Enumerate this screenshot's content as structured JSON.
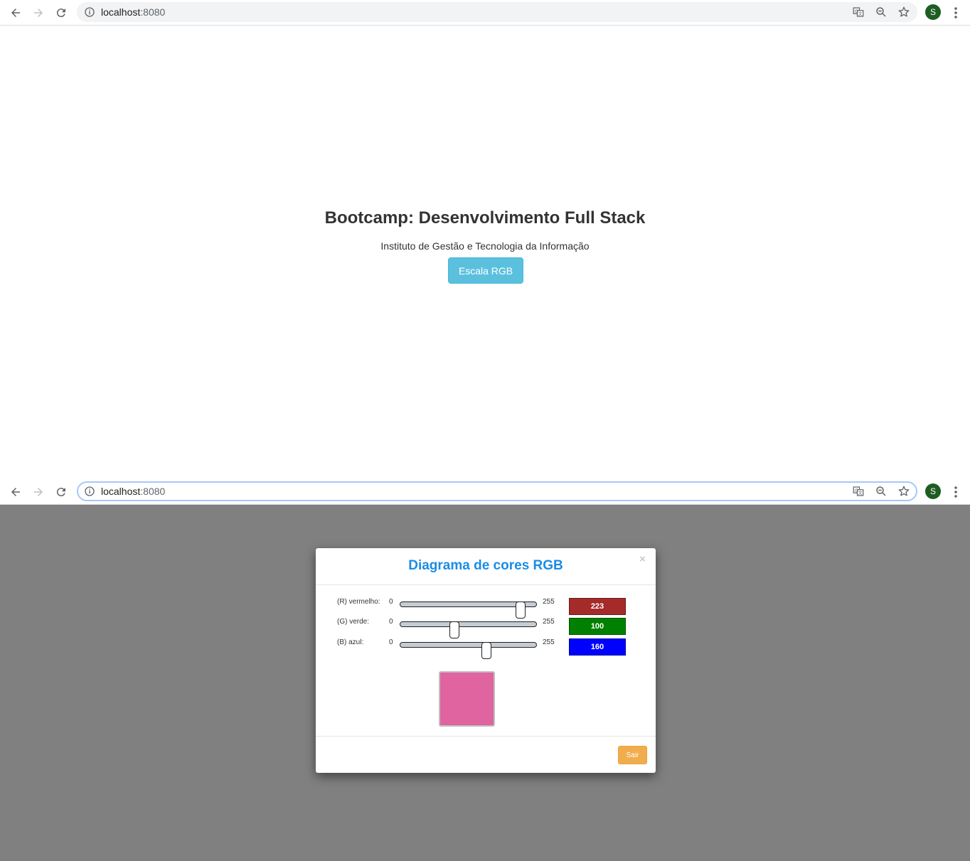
{
  "browser": {
    "url_host": "localhost",
    "url_port": ":8080",
    "profile_initial": "S"
  },
  "page": {
    "title": "Bootcamp: Desenvolvimento Full Stack",
    "subtitle": "Instituto de Gestão e Tecnologia da Informação",
    "open_button_label": "Escala RGB"
  },
  "modal": {
    "title": "Diagrama de cores RGB",
    "close_glyph": "×",
    "sliders": [
      {
        "label": "(R) vermelho:",
        "min": "0",
        "max": "255",
        "value": "223",
        "color": "#a52a2a"
      },
      {
        "label": "(G) verde:",
        "min": "0",
        "max": "255",
        "value": "100",
        "color": "#008000"
      },
      {
        "label": "(B) azul:",
        "min": "0",
        "max": "255",
        "value": "160",
        "color": "#0000ff"
      }
    ],
    "preview_color": "#df64a0",
    "exit_button_label": "Sair"
  },
  "colors": {
    "info_button": "#5bc0de",
    "warning_button": "#f0ad4e",
    "modal_title": "#1a8ce6"
  }
}
